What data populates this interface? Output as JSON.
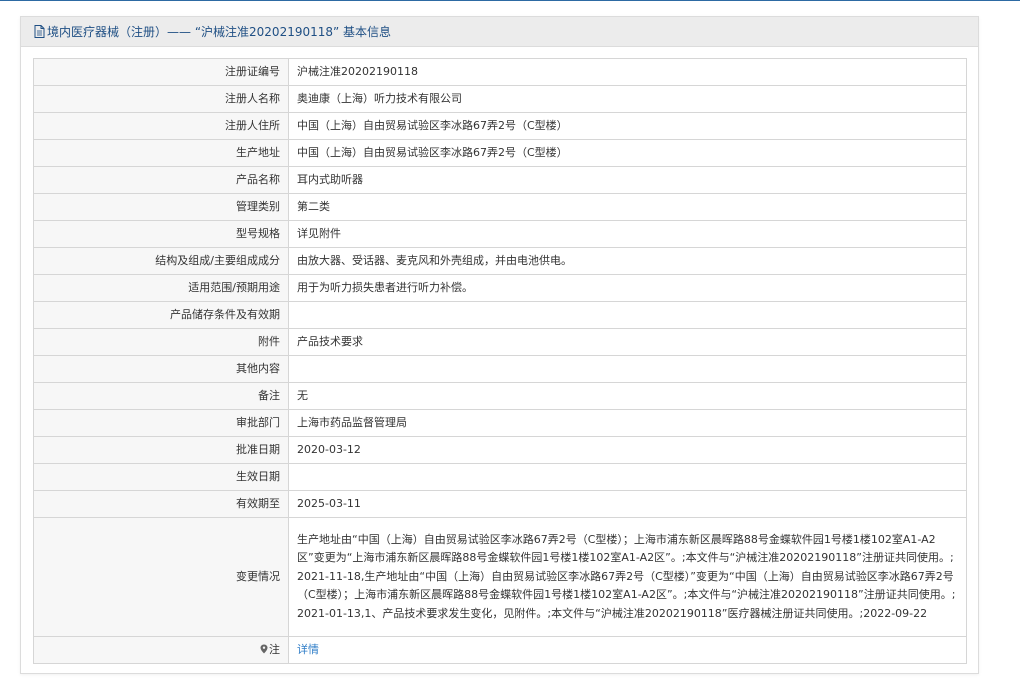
{
  "panel": {
    "title": "境内医疗器械（注册）——  “沪械注准20202190118”  基本信息"
  },
  "rows": [
    {
      "label": "注册证编号",
      "value": "沪械注准20202190118"
    },
    {
      "label": "注册人名称",
      "value": "奥迪康（上海）听力技术有限公司"
    },
    {
      "label": "注册人住所",
      "value": "中国（上海）自由贸易试验区李冰路67弄2号（C型楼）"
    },
    {
      "label": "生产地址",
      "value": "中国（上海）自由贸易试验区李冰路67弄2号（C型楼）"
    },
    {
      "label": "产品名称",
      "value": "耳内式助听器"
    },
    {
      "label": "管理类别",
      "value": "第二类"
    },
    {
      "label": "型号规格",
      "value": "详见附件"
    },
    {
      "label": "结构及组成/主要组成成分",
      "value": "由放大器、受话器、麦克风和外壳组成，并由电池供电。"
    },
    {
      "label": "适用范围/预期用途",
      "value": "用于为听力损失患者进行听力补偿。"
    },
    {
      "label": "产品储存条件及有效期",
      "value": ""
    },
    {
      "label": "附件",
      "value": "产品技术要求"
    },
    {
      "label": "其他内容",
      "value": ""
    },
    {
      "label": "备注",
      "value": "无"
    },
    {
      "label": "审批部门",
      "value": "上海市药品监督管理局"
    },
    {
      "label": "批准日期",
      "value": "2020-03-12"
    },
    {
      "label": "生效日期",
      "value": ""
    },
    {
      "label": "有效期至",
      "value": "2025-03-11"
    }
  ],
  "changes": {
    "label": "变更情况",
    "value": "生产地址由“中国（上海）自由贸易试验区李冰路67弄2号（C型楼）；上海市浦东新区晨晖路88号金蝶软件园1号楼1楼102室A1-A2区”变更为“上海市浦东新区晨晖路88号金蝶软件园1号楼1楼102室A1-A2区”。;本文件与“沪械注准20202190118”注册证共同使用。;2021-11-18,生产地址由“中国（上海）自由贸易试验区李冰路67弄2号（C型楼）”变更为“中国（上海）自由贸易试验区李冰路67弄2号（C型楼）；上海市浦东新区晨晖路88号金蝶软件园1号楼1楼102室A1-A2区”。;本文件与“沪械注准20202190118”注册证共同使用。;2021-01-13,1、产品技术要求发生变化，见附件。;本文件与“沪械注准20202190118”医疗器械注册证共同使用。;2022-09-22"
  },
  "note": {
    "label": "注",
    "link_text": "详情",
    "icon": "location-pin-icon"
  },
  "colors": {
    "title": "#1f4f84",
    "link": "#2d7cc7",
    "label_bg": "#f7f7f7",
    "border": "#d6d6d6",
    "top_rule": "#2d6aa3"
  }
}
